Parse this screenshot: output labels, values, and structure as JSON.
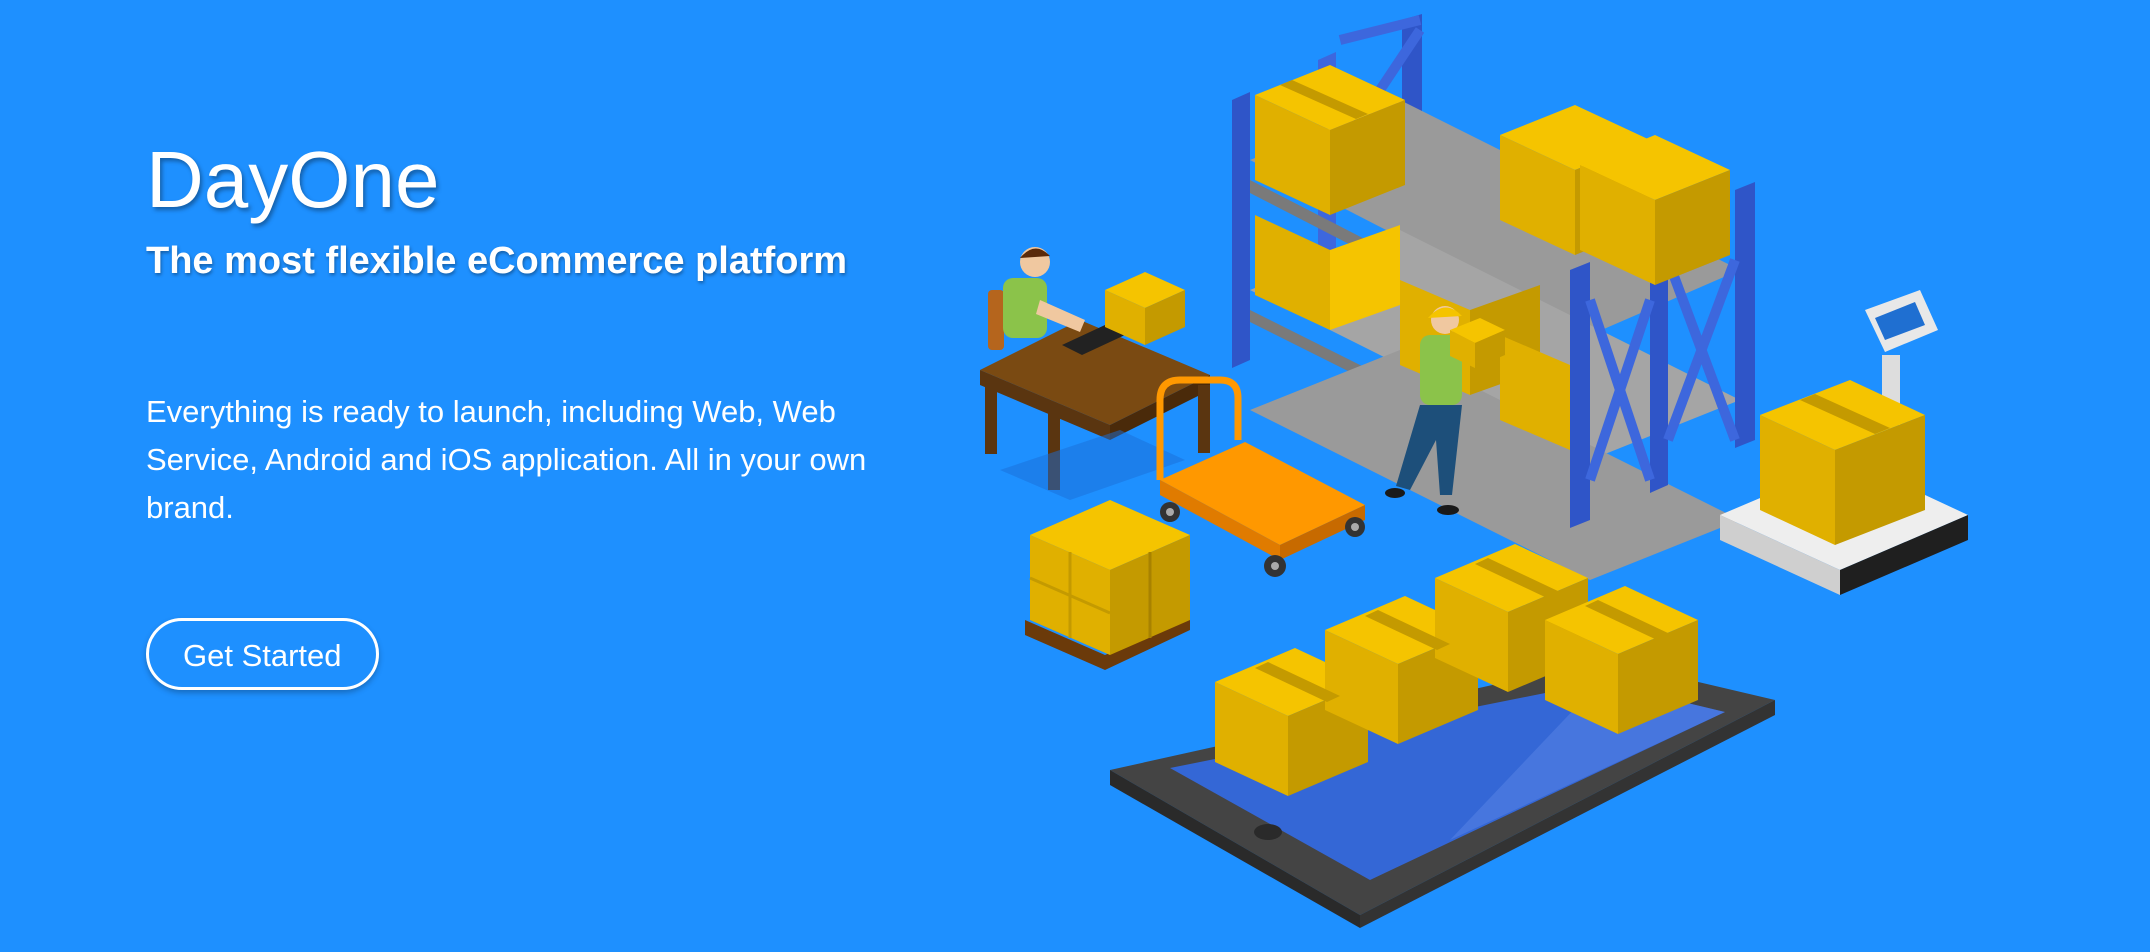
{
  "hero": {
    "title": "DayOne",
    "subtitle": "The most flexible eCommerce platform",
    "description": "Everything is ready to launch, including Web, Web Service, Android and iOS application. All in your own brand.",
    "cta_label": "Get Started"
  },
  "colors": {
    "background": "#1e90ff",
    "text": "#ffffff",
    "box": "#f5c400",
    "shelf_frame": "#2f55c8",
    "shelf_board": "#9a9a9a",
    "cart": "#ff9800",
    "tablet": "#444444",
    "tablet_screen": "#3467d6",
    "desk": "#6b4513"
  }
}
